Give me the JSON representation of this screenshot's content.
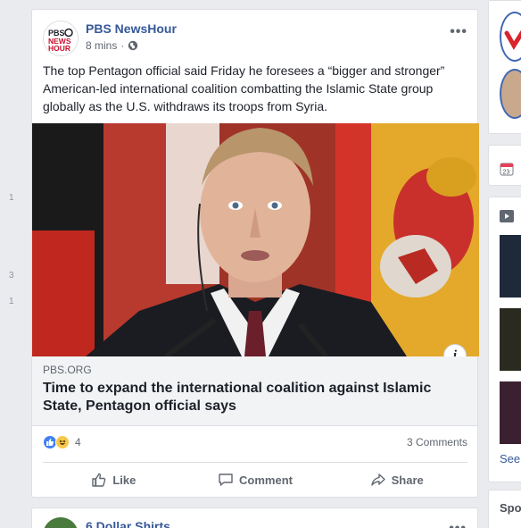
{
  "left_counts": [
    "1",
    "3",
    "1"
  ],
  "post": {
    "page_name": "PBS NewsHour",
    "avatar_logo_text": "PBS NEWS HOUR",
    "time": "8 mins",
    "more_label": "•••",
    "text": "The top Pentagon official said Friday he foresees a “bigger and stronger” American-led international coalition combatting the Islamic State group globally as the U.S. withdraws its troops from Syria.",
    "link": {
      "domain": "PBS.ORG",
      "title": "Time to expand the international coalition against Islamic State, Pentagon official says",
      "info_label": "i"
    },
    "reactions": {
      "count": "4",
      "comments": "3 Comments"
    },
    "actions": {
      "like": "Like",
      "comment": "Comment",
      "share": "Share"
    }
  },
  "post2": {
    "page_name": "6 Dollar Shirts",
    "more_label": "•••"
  },
  "right_column": {
    "calendar_day": "23",
    "see_label": "See",
    "sponsored_label": "Spo"
  },
  "colors": {
    "link_blue": "#365899",
    "background": "#e9ebee",
    "like_blue": "#3d81f5",
    "haha_yellow": "#f7c94a"
  }
}
